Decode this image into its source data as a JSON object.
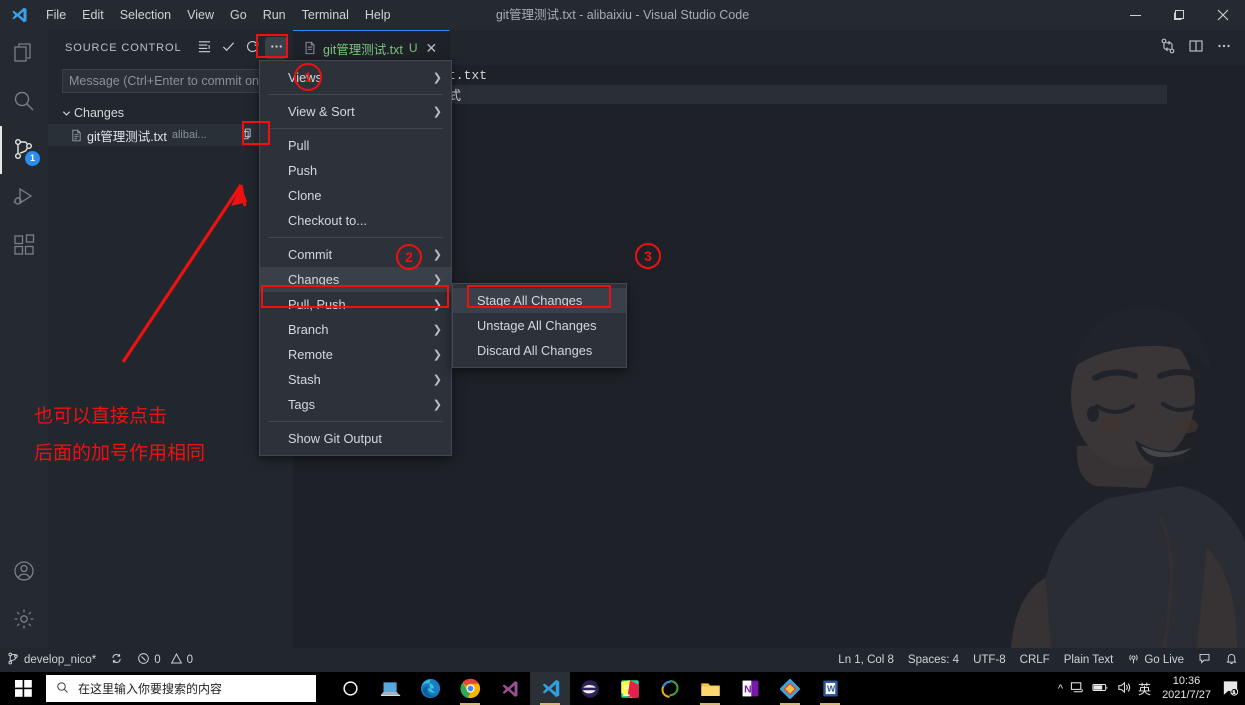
{
  "window": {
    "title": "git管理测试.txt - alibaixiu - Visual Studio Code",
    "minimize": "–",
    "maximize": "❐",
    "close": "✕"
  },
  "menubar": {
    "items": [
      {
        "label": "File"
      },
      {
        "label": "Edit"
      },
      {
        "label": "Selection"
      },
      {
        "label": "View"
      },
      {
        "label": "Go"
      },
      {
        "label": "Run"
      },
      {
        "label": "Terminal"
      },
      {
        "label": "Help"
      }
    ]
  },
  "activitybar": {
    "items": [
      {
        "name": "explorer",
        "icon": "files-icon"
      },
      {
        "name": "search",
        "icon": "search-icon"
      },
      {
        "name": "source-control",
        "icon": "source-control-icon",
        "badge": "1",
        "active": true
      },
      {
        "name": "run-debug",
        "icon": "run-debug-icon"
      },
      {
        "name": "extensions",
        "icon": "extensions-icon"
      }
    ],
    "bottom": [
      {
        "name": "accounts",
        "icon": "account-icon"
      },
      {
        "name": "settings",
        "icon": "gear-icon"
      }
    ]
  },
  "sidebar": {
    "title": "SOURCE CONTROL",
    "actions": [
      {
        "name": "view-as-tree",
        "icon": "list-icon"
      },
      {
        "name": "commit",
        "icon": "check-icon"
      },
      {
        "name": "refresh",
        "icon": "refresh-icon"
      },
      {
        "name": "more-actions",
        "icon": "ellipsis-icon"
      }
    ],
    "commit_placeholder": "Message (Ctrl+Enter to commit on",
    "group": {
      "label": "Changes",
      "files": [
        {
          "name": "git管理测试.txt",
          "description": "alibai...",
          "actions": [
            "open-file-icon",
            "discard-icon",
            "stage-icon"
          ]
        }
      ]
    }
  },
  "editor": {
    "tab": {
      "label": "git管理测试.txt",
      "badge": "U",
      "close": "✕"
    },
    "actions": [
      {
        "name": "split-editor-vertical",
        "icon": "split-icon"
      },
      {
        "name": "more-editor-actions",
        "icon": "ellipsis-icon"
      }
    ],
    "lines": [
      "t.txt",
      "式"
    ]
  },
  "context_menu": {
    "items": [
      {
        "label": "Views",
        "submenu": true
      },
      {
        "type": "separator"
      },
      {
        "label": "View & Sort",
        "submenu": true
      },
      {
        "type": "separator"
      },
      {
        "label": "Pull",
        "submenu": false
      },
      {
        "label": "Push",
        "submenu": false
      },
      {
        "label": "Clone",
        "submenu": false
      },
      {
        "label": "Checkout to...",
        "submenu": false
      },
      {
        "type": "separator"
      },
      {
        "label": "Commit",
        "submenu": true
      },
      {
        "label": "Changes",
        "submenu": true,
        "selected": true
      },
      {
        "label": "Pull, Push",
        "submenu": true
      },
      {
        "label": "Branch",
        "submenu": true
      },
      {
        "label": "Remote",
        "submenu": true
      },
      {
        "label": "Stash",
        "submenu": true
      },
      {
        "label": "Tags",
        "submenu": true
      },
      {
        "type": "separator"
      },
      {
        "label": "Show Git Output",
        "submenu": false
      }
    ]
  },
  "submenu": {
    "items": [
      {
        "label": "Stage All Changes",
        "highlighted": true
      },
      {
        "label": "Unstage All Changes"
      },
      {
        "label": "Discard All Changes"
      }
    ]
  },
  "statusbar": {
    "branch": "develop_nico*",
    "sync_icon": "sync-icon",
    "errors": "0",
    "warnings": "0",
    "position": "Ln 1, Col 8",
    "indentation": "Spaces: 4",
    "encoding": "UTF-8",
    "eol": "CRLF",
    "language": "Plain Text",
    "golive": "Go Live",
    "feedback_icon": "feedback-icon",
    "bell_icon": "bell-icon"
  },
  "taskbar": {
    "search_placeholder": "在这里输入你要搜索的内容",
    "tray": {
      "expand": "^",
      "network_icon": "network-icon",
      "battery_icon": "battery-icon",
      "volume_icon": "volume-icon",
      "ime": "英",
      "time": "10:36",
      "date": "2021/7/27",
      "notifications": "notification-icon"
    },
    "apps": [
      {
        "name": "cortana"
      },
      {
        "name": "task-view"
      },
      {
        "name": "microsoft-edge"
      },
      {
        "name": "google-chrome"
      },
      {
        "name": "visual-studio"
      },
      {
        "name": "visual-studio-code"
      },
      {
        "name": "eclipse"
      },
      {
        "name": "pycharm"
      },
      {
        "name": "webstorm"
      },
      {
        "name": "file-explorer"
      },
      {
        "name": "onenote"
      },
      {
        "name": "sketch-app"
      },
      {
        "name": "microsoft-word"
      }
    ]
  },
  "annotations": {
    "callout_1": "1",
    "callout_2": "2",
    "callout_3": "3",
    "note_line1": "也可以直接点击",
    "note_line2": "后面的加号作用相同",
    "accent_color": "#ee1111"
  }
}
